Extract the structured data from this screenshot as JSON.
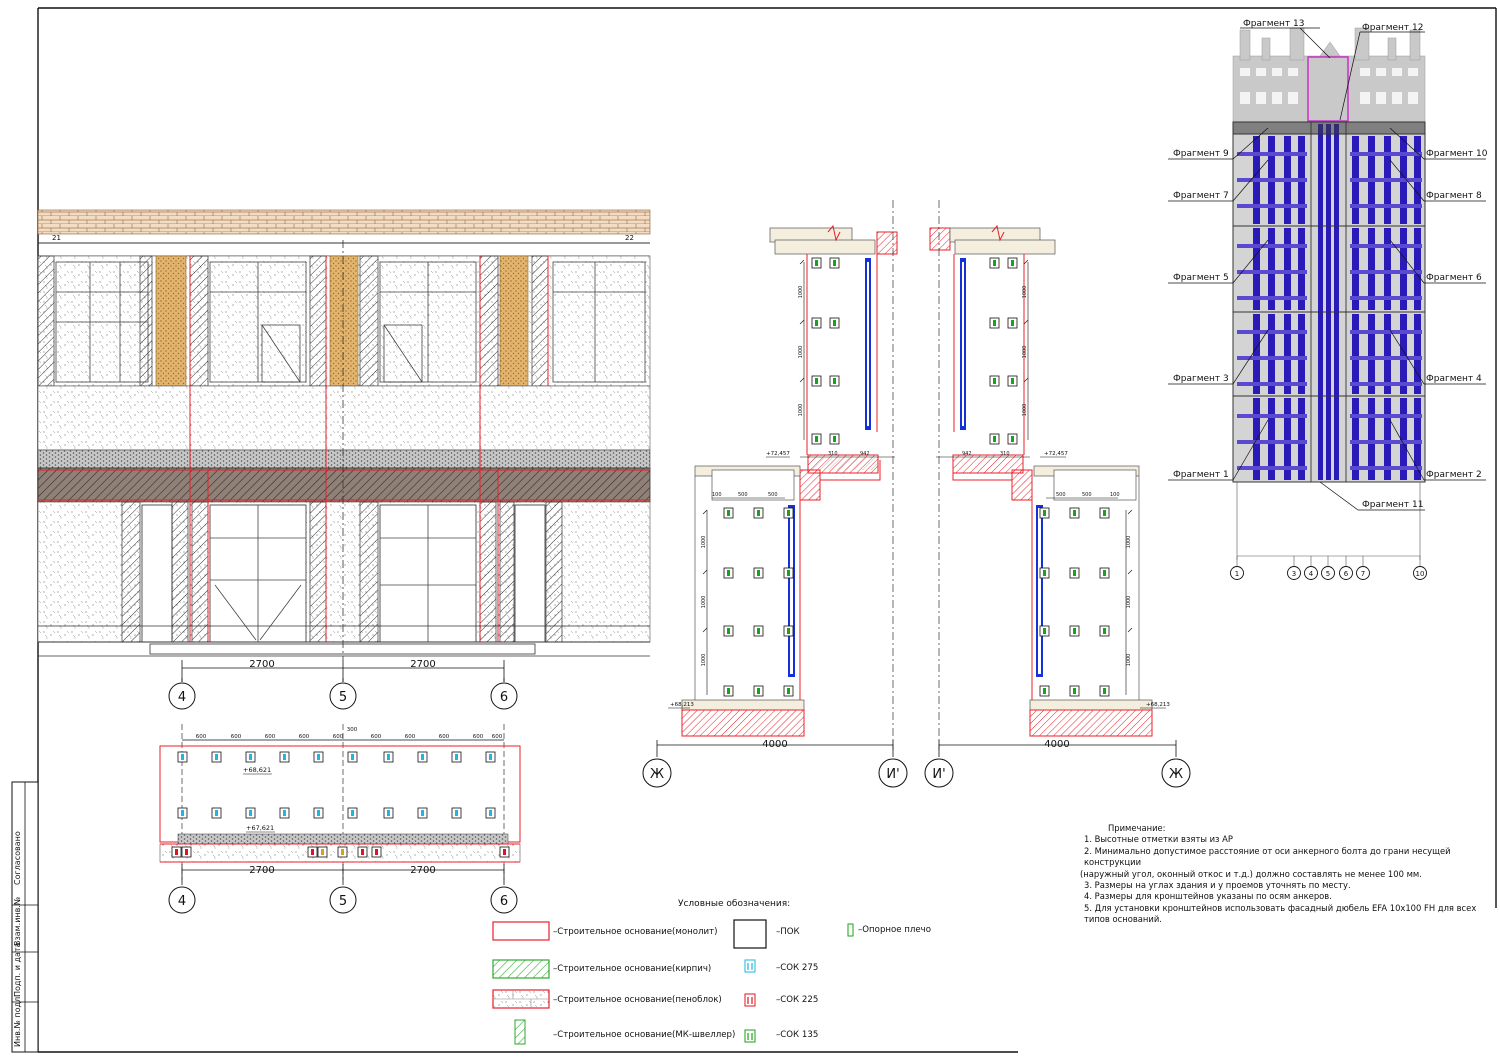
{
  "elevation": {
    "dims": [
      "2700",
      "2700"
    ],
    "axes": [
      "4",
      "5",
      "6"
    ],
    "marks": [
      "21",
      "22"
    ]
  },
  "plan": {
    "dims": [
      "2700",
      "2700"
    ],
    "axes": [
      "4",
      "5",
      "6"
    ],
    "levels": [
      "+68,621",
      "+67,621"
    ],
    "spacing": [
      "600",
      "600",
      "600",
      "600",
      "600",
      "300",
      "600",
      "600",
      "600",
      "600",
      "600"
    ]
  },
  "section_left": {
    "dim_total": "4000",
    "axes": [
      "Ж",
      "И'"
    ],
    "levels": [
      "+72,457",
      "+68,213"
    ],
    "small_dims": [
      "310",
      "942",
      "100",
      "500",
      "500"
    ],
    "v_dims": [
      "1000",
      "1000",
      "1000",
      "1000",
      "1000",
      "1000",
      "1000",
      "1000"
    ]
  },
  "section_right": {
    "dim_total": "4000",
    "axes": [
      "И'",
      "Ж"
    ],
    "levels": [
      "+72,457",
      "+68,213"
    ],
    "small_dims": [
      "942",
      "310",
      "500",
      "500",
      "100"
    ],
    "v_dims": [
      "1000",
      "1000",
      "1000",
      "1000",
      "1000",
      "1000",
      "1000",
      "1000"
    ]
  },
  "key_plan": {
    "fragments": {
      "f13": "Фрагмент 13",
      "f12": "Фрагмент 12",
      "f9": "Фрагмент 9",
      "f10": "Фрагмент 10",
      "f7": "Фрагмент 7",
      "f8": "Фрагмент 8",
      "f5": "Фрагмент 5",
      "f6": "Фрагмент 6",
      "f3": "Фрагмент 3",
      "f4": "Фрагмент 4",
      "f1": "Фрагмент 1",
      "f2": "Фрагмент 2",
      "f11": "Фрагмент 11"
    },
    "axes": [
      "1",
      "3",
      "4",
      "5",
      "6",
      "7",
      "10"
    ]
  },
  "notes": {
    "title": "Примечание:",
    "items": [
      "1. Высотные отметки взяты из АР",
      "2. Минимально допустимое расстояние от оси анкерного болта до грани несущей конструкции",
      "(наружный угол, оконный откос и т.д.) должно  составлять не менее 100 мм.",
      "3. Размеры на углах здания и у проемов уточнять по месту.",
      "4. Размеры для кронштейнов указаны по осям анкеров.",
      "5. Для установки кронштейнов использовать фасадный дюбель EFA 10x100 FH для всех типов оснований."
    ]
  },
  "legend": {
    "title": "Условные обозначения:",
    "monolith": "–Строительное основание(монолит)",
    "brick": "–Строительное основание(кирпич)",
    "foam": "–Строительное основание(пеноблок)",
    "channel": "–Строительное основание(МК-швеллер)",
    "pok": "–ПОК",
    "sok275": "–СОК 275",
    "sok225": "–СОК 225",
    "sok135": "–СОК 135",
    "support": "–Опорное плечо"
  },
  "stamp": {
    "labels": [
      "Согласовано",
      "Взам.инв.№",
      "Подп. и дата",
      "Инв.№ подл."
    ]
  },
  "colors": {
    "monolith": "#e8202a",
    "brick_hatch": "#2fa82f",
    "profile_blue": "#1432d8",
    "sok275": "#19b8e0",
    "sok225": "#e0141e",
    "sok135": "#1aa21a",
    "key_blue": "#2a1ab8",
    "key_frame": "#c832c8"
  }
}
